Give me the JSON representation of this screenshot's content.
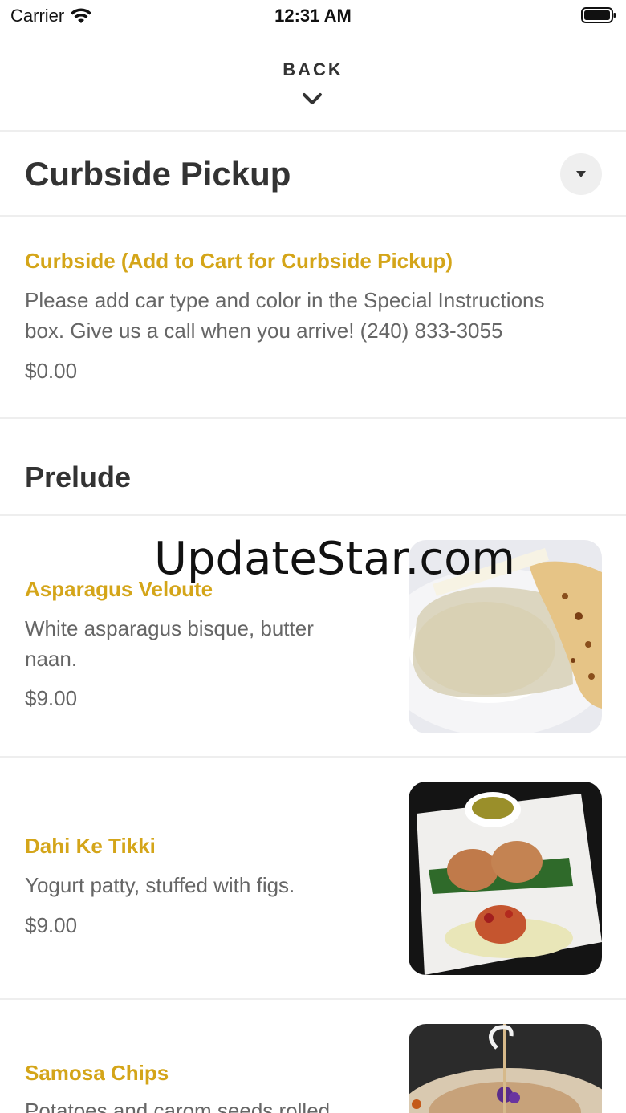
{
  "status_bar": {
    "carrier": "Carrier",
    "time": "12:31 AM"
  },
  "nav": {
    "back_label": "BACK"
  },
  "page": {
    "title": "Curbside Pickup"
  },
  "curbside": {
    "name": "Curbside (Add to Cart for Curbside Pickup)",
    "description": "Please add car type and color in the Special Instructions box. Give us a call when you arrive! (240) 833-3055",
    "price": "$0.00"
  },
  "section": {
    "title": "Prelude"
  },
  "items": [
    {
      "name": "Asparagus Veloute",
      "description": "White asparagus bisque, butter naan.",
      "price": "$9.00"
    },
    {
      "name": "Dahi Ke Tikki",
      "description": "Yogurt patty, stuffed with figs.",
      "price": "$9.00"
    },
    {
      "name": "Samosa Chips",
      "description": "Potatoes and carom seeds rolled"
    }
  ],
  "watermark": "UpdateStar.com",
  "colors": {
    "accent": "#d4a519",
    "text_dark": "#333333",
    "text_muted": "#666666",
    "divider": "#eeeeee"
  },
  "icons": {
    "back": "chevron-down-icon",
    "dropdown": "caret-down-icon",
    "wifi": "wifi-icon",
    "battery": "battery-icon"
  }
}
